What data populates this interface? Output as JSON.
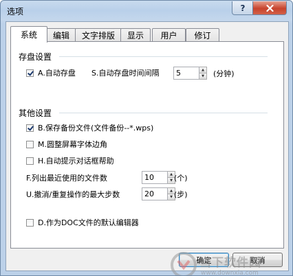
{
  "window": {
    "title": "选项",
    "help_label": "?",
    "close_icon": "close-icon",
    "close_color": "#c7432c"
  },
  "tabs": [
    {
      "label": "系统",
      "active": true
    },
    {
      "label": "编辑",
      "active": false
    },
    {
      "label": "文字排版",
      "active": false
    },
    {
      "label": "显示",
      "active": false
    },
    {
      "label": "用户",
      "active": false
    },
    {
      "label": "修订",
      "active": false
    }
  ],
  "save_group": {
    "title": "存盘设置",
    "autosave": {
      "label": "A.自动存盘",
      "checked": true
    },
    "interval": {
      "label": "S.自动存盘时间间隔",
      "value": "5",
      "unit": "(分钟)"
    }
  },
  "other_group": {
    "title": "其他设置",
    "backup": {
      "label": "B.保存备份文件(文件备份--*.wps)",
      "checked": true
    },
    "round_corner": {
      "label": "M.圆整屏幕字体边角",
      "checked": false
    },
    "auto_help": {
      "label": "H.自动提示对话框帮助",
      "checked": false
    },
    "recent_files": {
      "label": "F.列出最近使用的文件数",
      "value": "10",
      "unit": "(个)"
    },
    "undo_steps": {
      "label": "U.撤消/重复操作的最大步数",
      "value": "20",
      "unit": "(步)"
    },
    "default_editor": {
      "label": "D.作为DOC文件的默认编辑器",
      "checked": false
    }
  },
  "buttons": {
    "ok": "确定",
    "cancel": "取消"
  },
  "watermark": {
    "text": "当下软件园",
    "url": "www.downxia.com"
  }
}
